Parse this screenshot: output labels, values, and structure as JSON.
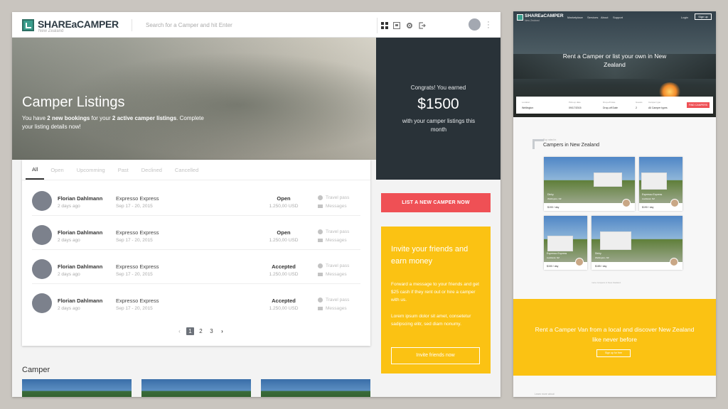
{
  "app": {
    "logo_text": "SHAREaCAMPER",
    "logo_sub": "New Zealand",
    "search_placeholder": "Search for a Camper and hit Enter"
  },
  "hero": {
    "title": "Camper Listings",
    "sub_1": "You have ",
    "sub_bold_1": "2 new bookings",
    "sub_2": " for your ",
    "sub_bold_2": "2 active camper listings",
    "sub_3": ". Complete your listing details now!"
  },
  "earnings": {
    "line1": "Congrats! You earned",
    "amount": "$1500",
    "line2": "with your camper listings this month"
  },
  "tabs": [
    "All",
    "Open",
    "Upcomming",
    "Past",
    "Declined",
    "Cancelled"
  ],
  "bookings": [
    {
      "name": "Florian Dahlmann",
      "ago": "2 days ago",
      "camper": "Expresso Express",
      "dates": "Sep 17 - 20, 2015",
      "status": "Open",
      "price": "1.250,00 USD",
      "link1": "Travel pass",
      "link2": "Messages"
    },
    {
      "name": "Florian Dahlmann",
      "ago": "2 days ago",
      "camper": "Expresso Express",
      "dates": "Sep 17 - 20, 2015",
      "status": "Open",
      "price": "1.250,00 USD",
      "link1": "Travel pass",
      "link2": "Messages"
    },
    {
      "name": "Florian Dahlmann",
      "ago": "2 days ago",
      "camper": "Expresso Express",
      "dates": "Sep 17 - 20, 2015",
      "status": "Accepted",
      "price": "1.250,00 USD",
      "link1": "Travel pass",
      "link2": "Messages"
    },
    {
      "name": "Florian Dahlmann",
      "ago": "2 days ago",
      "camper": "Expresso Express",
      "dates": "Sep 17 - 20, 2015",
      "status": "Accepted",
      "price": "1.250,00 USD",
      "link1": "Travel pass",
      "link2": "Messages"
    }
  ],
  "pagination": {
    "prev": "‹",
    "pages": [
      "1",
      "2",
      "3"
    ],
    "next": "›"
  },
  "camper_section": "Camper",
  "list_button": "LIST A NEW CAMPER NOW",
  "invite": {
    "title": "Invite your friends and earn money",
    "p1": "Forward a message to your friends and get $25 cash if they rent out or hire a camper with us.",
    "p2": "Lorem ipsum dolor sit amet, consetetur sadipscing elitr, sed diam nonumy.",
    "button": "Invite friends now"
  },
  "site": {
    "logo_text": "SHAREaCAMPER",
    "logo_sub": "New Zealand",
    "nav": [
      "Marketplace",
      "Services",
      "About",
      "Support"
    ],
    "signin": "Login",
    "signup": "Sign up",
    "hero_title": "Rent a Camper or list your own in New Zealand",
    "search_fields": [
      {
        "label": "Location",
        "value": "Wellington"
      },
      {
        "label": "Pick-up date",
        "value": "09/17/2015"
      },
      {
        "label": "Drop-off date",
        "value": "Drop-off Date"
      },
      {
        "label": "Guests",
        "value": "2"
      },
      {
        "label": "Camper type",
        "value": "All Camper types"
      }
    ],
    "find_button": "FIND CAMPERS",
    "section_sub": "Top rated in",
    "section_title": "Campers in New Zealand",
    "listings": [
      {
        "name": "Dinky",
        "location": "Wellington, NZ",
        "price": "$190 / day"
      },
      {
        "name": "Espresso Express",
        "location": "Auckland, NZ",
        "price": "$190 / day"
      },
      {
        "name": "Espresso Express",
        "location": "Auckland, NZ",
        "price": "$150 / day"
      },
      {
        "name": "Dinky",
        "location": "Wellington, NZ",
        "price": "$185 / day"
      }
    ],
    "more_link": "more campers in New Zealand",
    "cta_title": "Rent a Camper Van from a local and discover New Zealand like never before",
    "cta_button": "Sign up for free",
    "footer": "Learn more about"
  }
}
